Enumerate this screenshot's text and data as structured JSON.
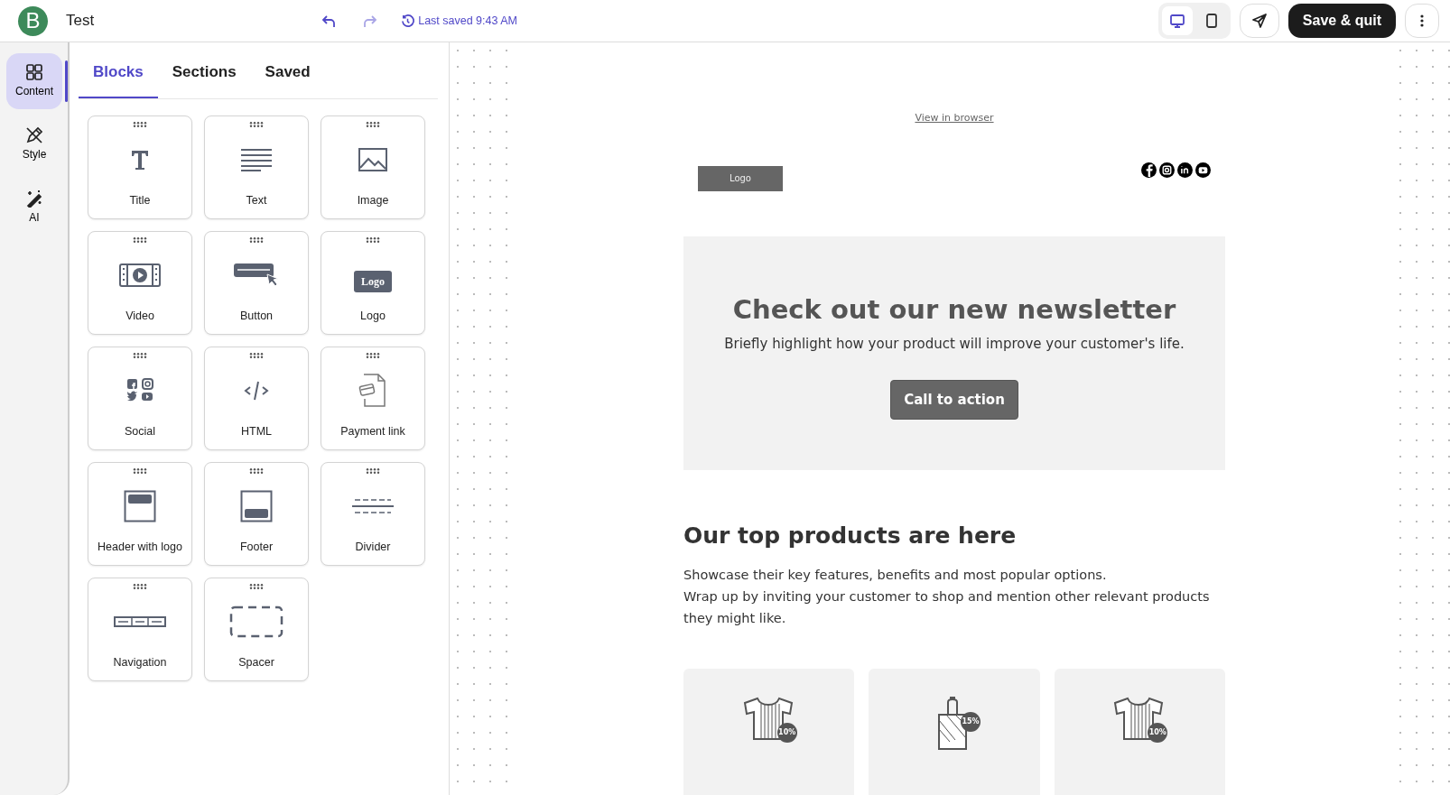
{
  "app": {
    "logo_letter": "B",
    "doc_title": "Test",
    "undo_enabled": true,
    "redo_enabled": false,
    "last_saved": "Last saved 9:43 AM"
  },
  "toolbar": {
    "devices": [
      {
        "kind": "desktop",
        "selected": true
      },
      {
        "kind": "mobile",
        "selected": false
      }
    ],
    "save_button": "Save & quit"
  },
  "rail": [
    {
      "kind": "content",
      "label": "Content",
      "selected": true
    },
    {
      "kind": "style",
      "label": "Style",
      "selected": false
    },
    {
      "kind": "ai",
      "label": "AI",
      "selected": false
    }
  ],
  "tabs": [
    {
      "label": "Blocks",
      "selected": true
    },
    {
      "label": "Sections",
      "selected": false
    },
    {
      "label": "Saved",
      "selected": false
    }
  ],
  "blocks": [
    {
      "kind": "title",
      "label": "Title"
    },
    {
      "kind": "text",
      "label": "Text"
    },
    {
      "kind": "image",
      "label": "Image"
    },
    {
      "kind": "video",
      "label": "Video"
    },
    {
      "kind": "button",
      "label": "Button"
    },
    {
      "kind": "logo",
      "label": "Logo",
      "icon_text": "Logo"
    },
    {
      "kind": "social",
      "label": "Social"
    },
    {
      "kind": "html",
      "label": "HTML"
    },
    {
      "kind": "payment",
      "label": "Payment link"
    },
    {
      "kind": "header",
      "label": "Header with logo"
    },
    {
      "kind": "footer",
      "label": "Footer"
    },
    {
      "kind": "divider",
      "label": "Divider"
    },
    {
      "kind": "navigation",
      "label": "Navigation"
    },
    {
      "kind": "spacer",
      "label": "Spacer"
    }
  ],
  "email": {
    "view_link": "View in browser",
    "logo": "Logo",
    "social": [
      {
        "kind": "facebook"
      },
      {
        "kind": "instagram"
      },
      {
        "kind": "linkedin"
      },
      {
        "kind": "youtube"
      }
    ],
    "hero": {
      "title": "Check out our new newsletter",
      "text": "Briefly highlight how your product will improve your customer's life.",
      "cta": "Call to action"
    },
    "products_title": "Our top products are here",
    "products_text": [
      "Showcase their key features, benefits and most popular options.",
      "Wrap up by inviting your customer to shop and mention other relevant products they might like."
    ],
    "products": [
      {
        "kind": "shirt",
        "badge": "10%"
      },
      {
        "kind": "bag",
        "badge": "15%"
      },
      {
        "kind": "shirt",
        "badge": "10%"
      }
    ]
  }
}
